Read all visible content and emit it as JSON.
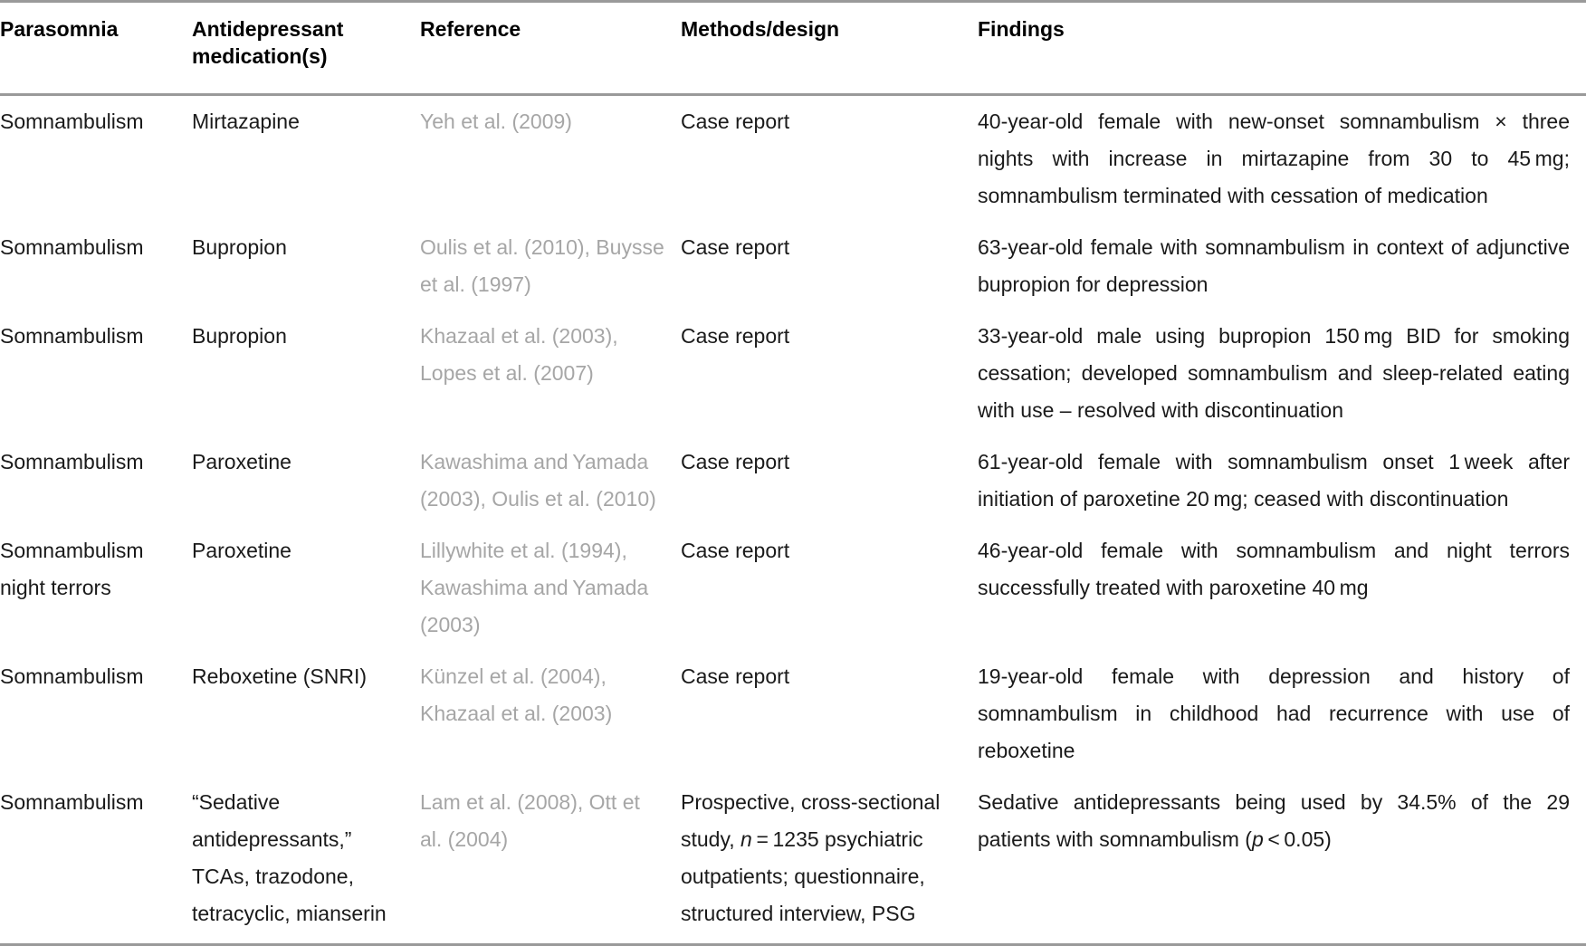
{
  "table": {
    "columns": [
      {
        "key": "parasomnia",
        "label": "Parasomnia"
      },
      {
        "key": "medication",
        "label": "Antidepressant medication(s)"
      },
      {
        "key": "reference",
        "label": "Reference"
      },
      {
        "key": "methods",
        "label": "Methods/design"
      },
      {
        "key": "findings",
        "label": "Findings"
      }
    ],
    "rows": [
      {
        "parasomnia": "Somnambulism",
        "medication": "Mirtazapine",
        "reference": "Yeh et al. (2009)",
        "methods": "Case report",
        "findings": "40-year-old female with new-onset somnambu­lism × three nights with increase in mirtazapine from 30 to 45 mg; somnambulism terminated with cessation of medication"
      },
      {
        "parasomnia": "Somnambulism",
        "medication": "Bupropion",
        "reference": "Oulis et al. (2010), Buysse et al. (1997)",
        "methods": "Case report",
        "findings": "63-year-old female with somnambulism in con­text of adjunctive bupropion for depression"
      },
      {
        "parasomnia": "Somnambulism",
        "medication": "Bupropion",
        "reference": "Khazaal et al. (2003), Lopes et al. (2007)",
        "methods": "Case report",
        "findings": "33-year-old male using bupropion 150 mg BID for smoking cessation; developed somnam­bulism and sleep-related eating with use – resolved with discontinuation"
      },
      {
        "parasomnia": "Somnambulism",
        "medication": "Paroxetine",
        "reference": "Kawashima and Yamada (2003), Oulis et al. (2010)",
        "methods": "Case report",
        "findings": "61-year-old female with somnambulism onset 1 week after initiation of paroxetine 20 mg; ceased with discontinuation"
      },
      {
        "parasomnia": "Somnambulism night terrors",
        "medication": "Paroxetine",
        "reference": "Lillywhite et al. (1994), Kawashima and Yamada (2003)",
        "methods": "Case report",
        "findings": "46-year-old female with somnambulism and night terrors successfully treated with paroxe­tine 40 mg"
      },
      {
        "parasomnia": "Somnambulism",
        "medication": "Reboxetine (SNRI)",
        "reference": "Künzel et al. (2004), Khazaal et al. (2003)",
        "methods": "Case report",
        "findings": "19-year-old female with depression and history of somnambulism in childhood had recurrence with use of reboxetine"
      },
      {
        "parasomnia": "Somnambulism",
        "medication": "“Sedative antidepressants,” TCAs, trazodone, tetracyclic, mianserin",
        "reference": "Lam et al. (2008), Ott et al. (2004)",
        "methods": "Prospective, cross-sectional study, n = 1235 psychiatric outpatients; questionnaire, structured interview, PSG",
        "findings": "Sedative antidepressants being used by 34.5% of the 29 patients with somnambulism (p < 0.05)"
      }
    ]
  },
  "style": {
    "rule_color": "#9a9a9a",
    "reference_color": "#a6a6a6",
    "text_color": "#1a1a1a",
    "background": "#ffffff"
  }
}
